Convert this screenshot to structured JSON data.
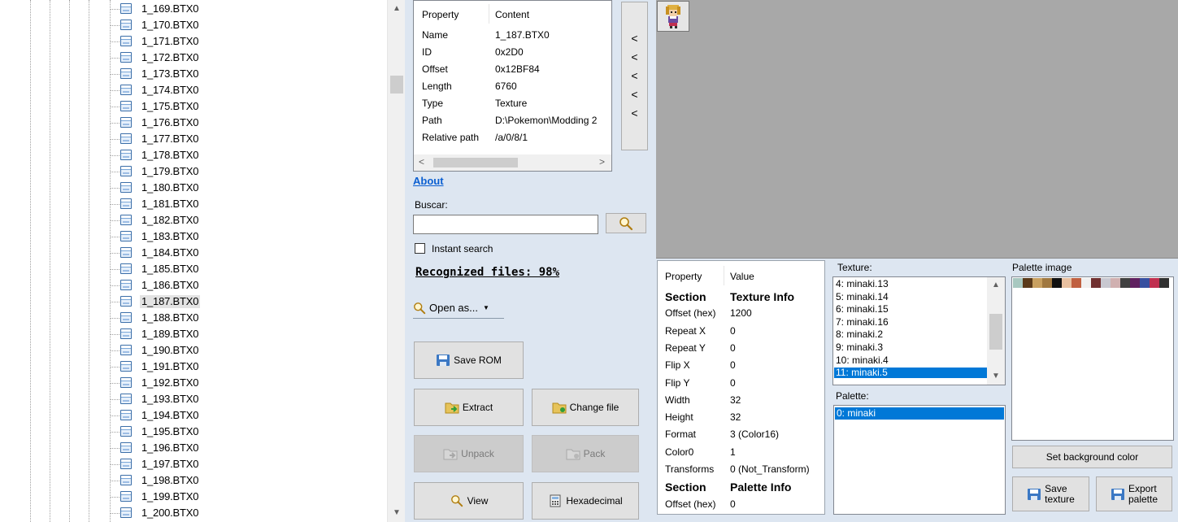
{
  "tree": {
    "items": [
      "1_169.BTX0",
      "1_170.BTX0",
      "1_171.BTX0",
      "1_172.BTX0",
      "1_173.BTX0",
      "1_174.BTX0",
      "1_175.BTX0",
      "1_176.BTX0",
      "1_177.BTX0",
      "1_178.BTX0",
      "1_179.BTX0",
      "1_180.BTX0",
      "1_181.BTX0",
      "1_182.BTX0",
      "1_183.BTX0",
      "1_184.BTX0",
      "1_185.BTX0",
      "1_186.BTX0",
      "1_187.BTX0",
      "1_188.BTX0",
      "1_189.BTX0",
      "1_190.BTX0",
      "1_191.BTX0",
      "1_192.BTX0",
      "1_193.BTX0",
      "1_194.BTX0",
      "1_195.BTX0",
      "1_196.BTX0",
      "1_197.BTX0",
      "1_198.BTX0",
      "1_199.BTX0",
      "1_200.BTX0"
    ],
    "selected_index": 18
  },
  "properties": {
    "header_property": "Property",
    "header_content": "Content",
    "rows": [
      {
        "k": "Name",
        "v": "1_187.BTX0"
      },
      {
        "k": "ID",
        "v": "0x2D0"
      },
      {
        "k": "Offset",
        "v": "0x12BF84"
      },
      {
        "k": "Length",
        "v": "6760"
      },
      {
        "k": "Type",
        "v": "Texture"
      },
      {
        "k": "Path",
        "v": "D:\\Pokemon\\Modding 2"
      },
      {
        "k": "Relative path",
        "v": "/a/0/8/1"
      }
    ],
    "scroll_left": "<",
    "scroll_right": ">"
  },
  "arrow_buttons": [
    "<",
    "<",
    "<",
    "<",
    "<"
  ],
  "about_label": "About",
  "search": {
    "label": "Buscar:",
    "value": "",
    "instant_label": "Instant search",
    "instant_checked": false
  },
  "recognized_text": "Recognized files: 98%",
  "open_as_label": "Open as...",
  "buttons": {
    "save_rom": "Save ROM",
    "extract": "Extract",
    "change_file": "Change file",
    "unpack": "Unpack",
    "pack": "Pack",
    "view": "View",
    "hexadecimal": "Hexadecimal",
    "set_background": "Set background color",
    "save_texture_1": "Save",
    "save_texture_2": "texture",
    "export_palette_1": "Export",
    "export_palette_2": "palette"
  },
  "info": {
    "header_property": "Property",
    "header_value": "Value",
    "rows": [
      {
        "k": "Section",
        "v": "Texture Info",
        "section": true
      },
      {
        "k": "Offset (hex)",
        "v": "1200"
      },
      {
        "k": "Repeat X",
        "v": "0"
      },
      {
        "k": "Repeat Y",
        "v": "0"
      },
      {
        "k": "Flip X",
        "v": "0"
      },
      {
        "k": "Flip Y",
        "v": "0"
      },
      {
        "k": "Width",
        "v": "32"
      },
      {
        "k": "Height",
        "v": "32"
      },
      {
        "k": "Format",
        "v": "3 (Color16)"
      },
      {
        "k": "Color0",
        "v": "1"
      },
      {
        "k": "Transforms",
        "v": "0 (Not_Transform)"
      },
      {
        "k": "Section",
        "v": "Palette Info",
        "section": true
      },
      {
        "k": "Offset (hex)",
        "v": "0"
      }
    ]
  },
  "texture": {
    "label": "Texture:",
    "items": [
      "4: minaki.13",
      "5: minaki.14",
      "6: minaki.15",
      "7: minaki.16",
      "8: minaki.2",
      "9: minaki.3",
      "10: minaki.4",
      "11: minaki.5"
    ],
    "selected_index": 7
  },
  "palette": {
    "label": "Palette:",
    "items": [
      "0: minaki"
    ],
    "selected_index": 0
  },
  "palette_image": {
    "label": "Palette image",
    "colors": [
      "#a8c8c0",
      "#5a3a1a",
      "#c8a060",
      "#a07840",
      "#101010",
      "#e8c0a0",
      "#c06040",
      "#f0f0f0",
      "#703030",
      "#c8c8d0",
      "#d0b0b0",
      "#404040",
      "#602060",
      "#3850a0",
      "#c03050",
      "#303030"
    ]
  }
}
